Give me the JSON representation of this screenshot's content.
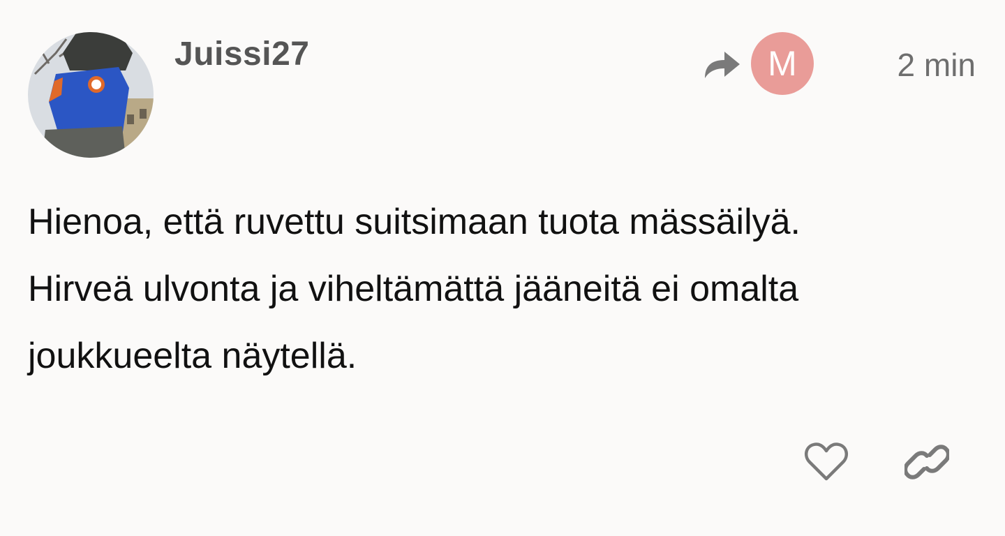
{
  "post": {
    "username": "Juissi27",
    "reply_to_initial": "M",
    "time": "2 min",
    "body_lines": [
      "Hienoa, että ruvettu suitsimaan tuota mässäilyä.",
      "Hirveä ulvonta ja viheltämättä jääneitä ei omalta",
      "joukkueelta näytellä."
    ]
  },
  "icons": {
    "avatar": "user-avatar-photo",
    "reply": "reply-arrow-icon",
    "like": "heart-icon",
    "link": "link-icon"
  },
  "colors": {
    "background": "#fbfaf9",
    "username": "#555555",
    "reply_avatar_bg": "#e99c98",
    "icon_gray": "#7a7a7a",
    "text": "#111111"
  }
}
